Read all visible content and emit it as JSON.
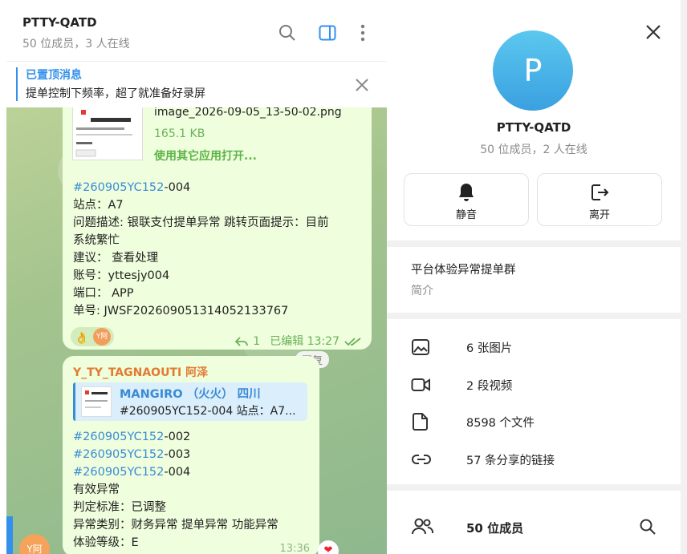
{
  "chat": {
    "title": "PTTY-QATD",
    "subtitle": "50 位成员，3 人在线",
    "pinned": {
      "title": "已置顶消息",
      "text": "提单控制下频率，超了就准备好录屏"
    },
    "message1": {
      "file_name": "image_2026-09-05_13-50-02.png",
      "file_size": "165.1 KB",
      "open_with": "使用其它应用打开...",
      "tag": "#260905YC152",
      "tag_suffix": "-004",
      "station": "站点：A7",
      "problem_line1": "问题描述: 银联支付提单异常 跳转页面提示：目前",
      "problem_line2": "系统繁忙",
      "suggestion": "建议： 查看处理",
      "account": "账号：yttesjy004",
      "port": "端口： APP",
      "order": "单号: JWSF20260905131405213376",
      "order_tail": "7",
      "reaction_emoji": "👌",
      "reaction_avatar": "Y阿",
      "reply_count": "1",
      "edited_time": "已编辑 13:27"
    },
    "reply_chip": "回复",
    "message2": {
      "sender": "Y_TY_TAGNAOUTI 阿泽",
      "reply_name": "MANGIRO （火火） 四川",
      "reply_text": "#260905YC152-004 站点：A7...",
      "tags": [
        {
          "tag": "#260905YC152",
          "suffix": "-002"
        },
        {
          "tag": "#260905YC152",
          "suffix": "-003"
        },
        {
          "tag": "#260905YC152",
          "suffix": "-004"
        }
      ],
      "line_valid": "有效异常",
      "line_criteria": "判定标准：已调整",
      "line_category": "异常类别：财务异常  提单异常  功能异常",
      "line_level": "体验等级：E",
      "time": "13:36",
      "heart": "❤"
    },
    "sender_avatar": "Y阿"
  },
  "panel": {
    "avatar_letter": "P",
    "name": "PTTY-QATD",
    "subtitle": "50 位成员，2 人在线",
    "mute_label": "静音",
    "leave_label": "离开",
    "description": "平台体验异常提单群",
    "description_label": "简介",
    "media": [
      {
        "icon": "image-icon",
        "label": "6 张图片"
      },
      {
        "icon": "video-icon",
        "label": "2 段视频"
      },
      {
        "icon": "file-icon",
        "label": "8598 个文件"
      },
      {
        "icon": "link-icon",
        "label": "57 条分享的链接"
      }
    ],
    "members_label": "50 位成员"
  },
  "colors": {
    "accent": "#3390ec",
    "bubble": "#effedd",
    "sender": "#e27a30",
    "green_meta": "#6ab158"
  }
}
